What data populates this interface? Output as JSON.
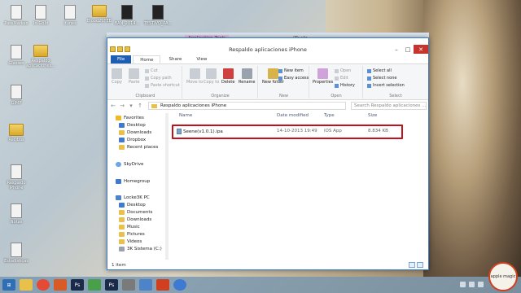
{
  "desktop": {
    "icons": [
      {
        "label": "PassMarkeo",
        "kind": "doc"
      },
      {
        "label": "In-Gold",
        "kind": "doc"
      },
      {
        "label": "Itunes",
        "kind": "doc"
      },
      {
        "label": "Blood2STEB",
        "kind": "folder"
      },
      {
        "label": "BAN_2014...",
        "kind": "dark"
      },
      {
        "label": "TESTIVO_PA...",
        "kind": "dark"
      },
      {
        "label": "Glasses",
        "kind": "doc"
      },
      {
        "label": "Respaldo aplicaciones...",
        "kind": "folder"
      },
      {
        "label": "GIMP",
        "kind": "doc"
      },
      {
        "label": "Recibos",
        "kind": "folder"
      },
      {
        "label": "Respaldo iPhone",
        "kind": "doc"
      },
      {
        "label": "Notas",
        "kind": "doc"
      },
      {
        "label": "Estadísticas",
        "kind": "doc"
      }
    ]
  },
  "app_bar": {
    "tools_tab": "Application Tools",
    "app_title": "iTools"
  },
  "window": {
    "title": "Respaldo aplicaciones iPhone",
    "tabs": [
      "File",
      "Home",
      "Share",
      "View"
    ],
    "ribbon": {
      "clipboard": {
        "label": "Clipboard",
        "copy": "Copy",
        "paste": "Paste",
        "cut": "Cut",
        "copy_path": "Copy path",
        "paste_shortcut": "Paste shortcut"
      },
      "organize": {
        "label": "Organize",
        "move_to": "Move to",
        "copy_to": "Copy to",
        "delete": "Delete",
        "rename": "Rename"
      },
      "new": {
        "label": "New",
        "new_folder": "New folder",
        "new_item": "New item",
        "easy_access": "Easy access"
      },
      "open": {
        "label": "Open",
        "properties": "Properties",
        "open": "Open",
        "edit": "Edit",
        "history": "History"
      },
      "select": {
        "label": "Select",
        "select_all": "Select all",
        "select_none": "Select none",
        "invert_selection": "Invert selection"
      }
    },
    "address": {
      "path": "Respaldo aplicaciones iPhone",
      "search_placeholder": "Search Respaldo aplicaciones ..."
    },
    "nav_pane": {
      "favorites": "Favorites",
      "favorites_items": [
        "Desktop",
        "Downloads",
        "Dropbox",
        "Recent places"
      ],
      "skydrive": "SkyDrive",
      "homegroup": "Homegroup",
      "pc": "Locke3K PC",
      "pc_items": [
        "Desktop",
        "Documents",
        "Downloads",
        "Music",
        "Pictures",
        "Videos",
        "3K Sistema (C:)"
      ]
    },
    "columns": {
      "name": "Name",
      "date": "Date modified",
      "type": "Type",
      "size": "Size"
    },
    "files": [
      {
        "name": "Seene(v1.0.1).ipa",
        "date": "14-10-2013 19:49",
        "type": "iOS App",
        "size": "8.834 KB"
      }
    ],
    "status": "1 item"
  },
  "branding": {
    "corner_logo": "apple magic"
  },
  "colors": {
    "accent": "#1e5fb4",
    "highlight": "#c2111a",
    "window_border": "#3b7cc9"
  }
}
